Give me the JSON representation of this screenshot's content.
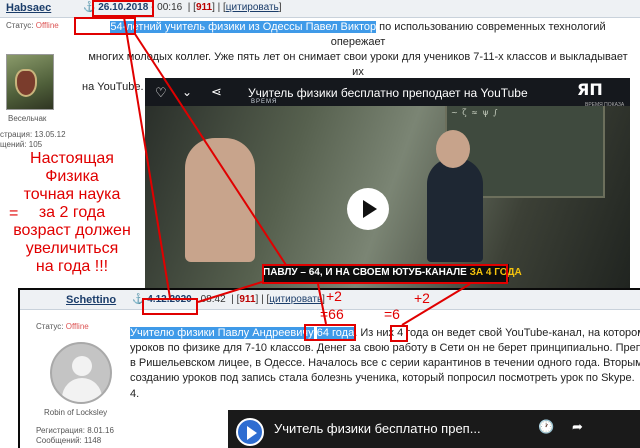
{
  "post1": {
    "username": "Habsaec",
    "status_label": "Статус:",
    "status_value": "Offline",
    "rank": "Весельчак",
    "registration": "страция: 13.05.12",
    "messages": "щений: 105",
    "date": "26.10.2018",
    "time": "- 00:16",
    "post_number": "911",
    "quote_link": "цитировать",
    "text_highlight": "54-летний",
    "text_line1_rest": " учитель физики из Одессы Павел Виктор",
    "text_line1_tail": " по использованию современных технологий опережает",
    "text_line2": "многих молодых коллег. Уже пять лет он снимает свои уроки для учеников 7-11-х классов и выкладывает их",
    "text_line3": "на YouTube."
  },
  "video1": {
    "title": "Учитель физики бесплатно преподает на YouTube",
    "channel": "ВРЕМЯ",
    "channel_right": "ВРЕМЯ ПОКАЗА",
    "logo": "ЯП",
    "board_text": "~ ζ ≈ ψ ∫",
    "caption_part1": "ПАВЛУ – 64, И НА СВОЕМ ЮТУБ-КАНАЛЕ ",
    "caption_part2": "ЗА 4 ГОДА"
  },
  "annotation": {
    "line1": "Настоящая",
    "line2": "Физика",
    "line3": "точная наука",
    "line4": "за 2 года",
    "line5": "возраст должен",
    "line6": "увеличиться",
    "line7": "на года !!!",
    "eq_sign": "="
  },
  "post2": {
    "username": "Schettino",
    "status_label": "Статус:",
    "status_value": "Offline",
    "rank": "Robin of Locksley",
    "registration": "Регистрация: 8.01.16",
    "messages": "Сообщений: 1148",
    "date": "4.12.2020",
    "time": "- 08:42",
    "post_number": "911",
    "quote_link": "цитировать",
    "text_highlight": "Учителю физики Павлу Андреевичу",
    "text_age": "64 года",
    "text_line1_mid": ". Из них ",
    "text_years": "4",
    "text_line1_tail": " года он ведет свой YouTube-канал, на котором",
    "text_line2": "уроков по физике для 7-10 классов. Денег за свою работу в Сети он не берет принципиально. Преп",
    "text_line3": "в Ришельевском лицее, в Одессе. Началось все с серии карантинов в течении одного года. Вторым т",
    "text_line4": "созданию уроков под запись стала болезнь ученика, который попросил посмотреть урок по Skype.",
    "text_line5": "4."
  },
  "video2": {
    "title": "Учитель физики бесплатно преп..."
  },
  "marks": {
    "plus_left": "+2",
    "plus_right": "+2",
    "eq_left": "=66",
    "eq_right": "=6"
  },
  "icons": {
    "pin": "⚓",
    "heart": "♡",
    "chevron": "⌄",
    "share": "⋖",
    "clock": "🕐",
    "share2": "➦"
  },
  "colors": {
    "accent_red": "#e00000",
    "highlight_blue": "#3f9ae8",
    "link_blue": "#1b3d6a"
  }
}
